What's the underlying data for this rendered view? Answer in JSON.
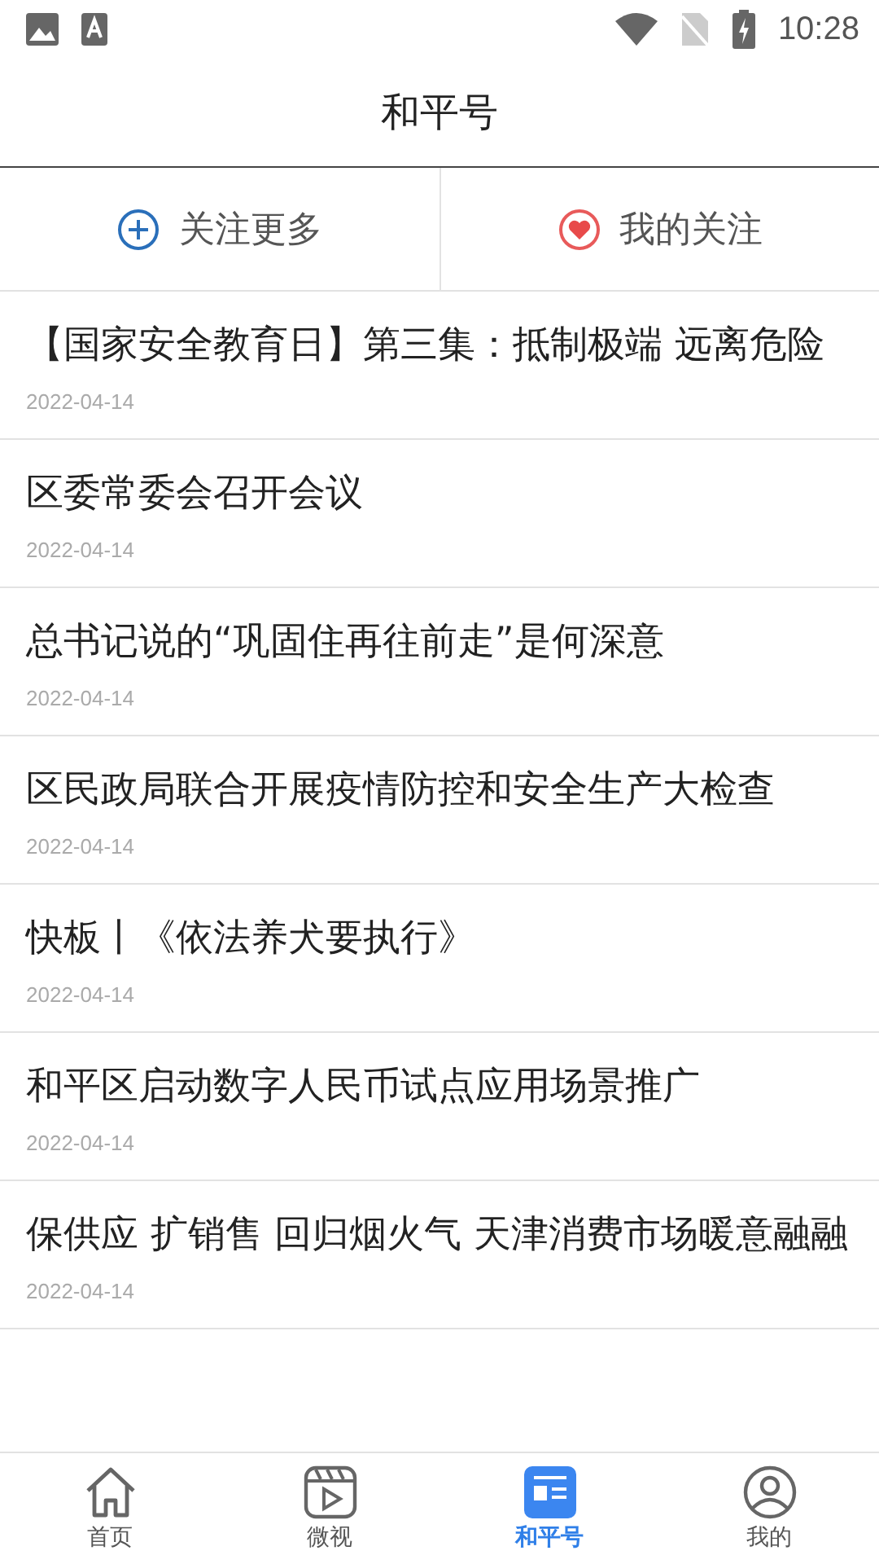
{
  "status_bar": {
    "time": "10:28"
  },
  "header": {
    "title": "和平号"
  },
  "actions": [
    {
      "kind": "add",
      "label": "关注更多"
    },
    {
      "kind": "heart",
      "label": "我的关注"
    }
  ],
  "articles": [
    {
      "title": "【国家安全教育日】第三集：抵制极端 远离危险",
      "date": "2022-04-14"
    },
    {
      "title": "区委常委会召开会议",
      "date": "2022-04-14"
    },
    {
      "title": "总书记说的“巩固住再往前走”是何深意",
      "date": "2022-04-14"
    },
    {
      "title": "区民政局联合开展疫情防控和安全生产大检查",
      "date": "2022-04-14"
    },
    {
      "title": "快板丨《依法养犬要执行》",
      "date": "2022-04-14"
    },
    {
      "title": "和平区启动数字人民币试点应用场景推广",
      "date": "2022-04-14"
    },
    {
      "title": "保供应 扩销售 回归烟火气 天津消费市场暖意融融",
      "date": "2022-04-14"
    }
  ],
  "tabs": [
    {
      "kind": "home",
      "label": "首页",
      "selected": false
    },
    {
      "kind": "video",
      "label": "微视",
      "selected": false
    },
    {
      "kind": "news",
      "label": "和平号",
      "selected": true
    },
    {
      "kind": "profile",
      "label": "我的",
      "selected": false
    }
  ]
}
